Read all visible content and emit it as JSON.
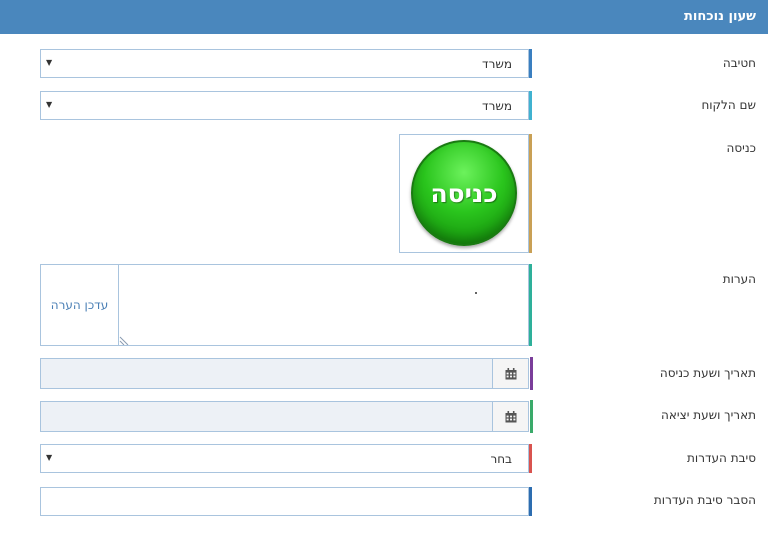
{
  "header": {
    "title": "שעון נוכחות"
  },
  "fields": {
    "division": {
      "label": "חטיבה",
      "value": "משרד"
    },
    "customer": {
      "label": "שם הלקוח",
      "value": "משרד"
    },
    "entry": {
      "label": "כניסה",
      "button": "כניסה"
    },
    "notes": {
      "label": "הערות",
      "update_button": "עדכן הערה",
      "value": ""
    },
    "entry_datetime": {
      "label": "תאריך ושעת כניסה",
      "value": ""
    },
    "exit_datetime": {
      "label": "תאריך ושעת יציאה",
      "value": ""
    },
    "absence_reason": {
      "label": "סיבת העדרות",
      "value": "בחר"
    },
    "absence_explanation": {
      "label": "הסבר סיבת העדרות",
      "value": ""
    }
  },
  "icons": {
    "select_arrow": "caret-down-icon",
    "calendar": "calendar-icon"
  },
  "colors": {
    "header": "#4a87bd",
    "accent_division": "#3a7fc0",
    "accent_customer": "#40b2d0",
    "accent_entry": "#c9a055",
    "accent_notes": "#2eb09a",
    "accent_entry_date": "#7a3d9a",
    "accent_exit_date": "#3aaa6a",
    "accent_absence": "#d9534f",
    "accent_explanation": "#2d6db0",
    "enter_button": "#22b818"
  }
}
